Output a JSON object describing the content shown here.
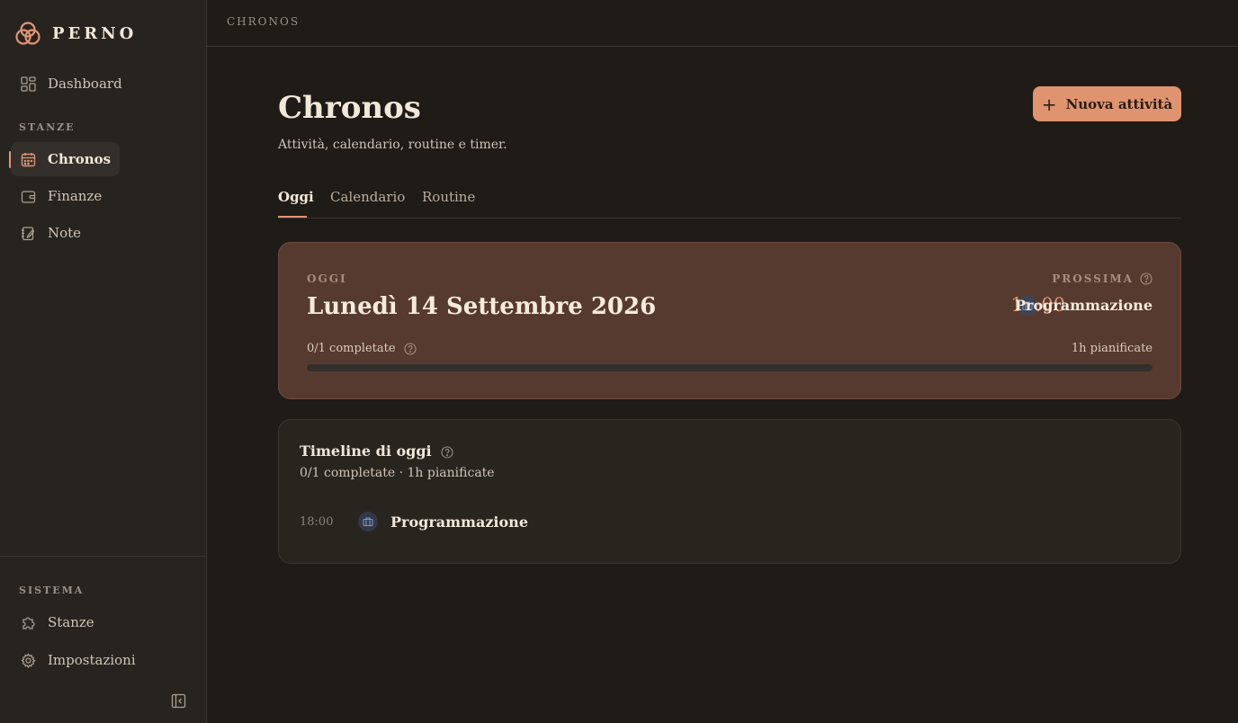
{
  "brand": {
    "name": "PERNO"
  },
  "sidebar": {
    "dashboard_label": "Dashboard",
    "section_rooms": "STANZE",
    "items": [
      {
        "label": "Chronos",
        "icon": "calendar-icon",
        "active": true
      },
      {
        "label": "Finanze",
        "icon": "wallet-icon",
        "active": false
      },
      {
        "label": "Note",
        "icon": "note-icon",
        "active": false
      }
    ],
    "section_system": "SISTEMA",
    "system_items": [
      {
        "label": "Stanze",
        "icon": "puzzle-icon"
      },
      {
        "label": "Impostazioni",
        "icon": "gear-icon"
      }
    ]
  },
  "topbar": {
    "title": "CHRONOS"
  },
  "page": {
    "title": "Chronos",
    "subtitle": "Attività, calendario, routine e timer.",
    "new_button": "Nuova attività"
  },
  "tabs": [
    {
      "label": "Oggi",
      "active": true
    },
    {
      "label": "Calendario",
      "active": false
    },
    {
      "label": "Routine",
      "active": false
    }
  ],
  "today": {
    "label": "OGGI",
    "date": "Lunedì 14 Settembre 2026",
    "next_label": "PROSSIMA",
    "next_time": "18:00",
    "next_name": "Programmazione",
    "completed_text": "0/1 completate",
    "planned_text": "1h pianificate",
    "progress": 0
  },
  "timeline": {
    "title": "Timeline di oggi",
    "subtitle": "0/1 completate · 1h pianificate",
    "items": [
      {
        "time": "18:00",
        "name": "Programmazione",
        "icon": "briefcase-icon"
      }
    ]
  },
  "colors": {
    "accent": "#e09573",
    "background": "#1f1b17",
    "sidebar": "#272420",
    "today_card": "#573a2f",
    "event_icon": "#7d94c9"
  }
}
